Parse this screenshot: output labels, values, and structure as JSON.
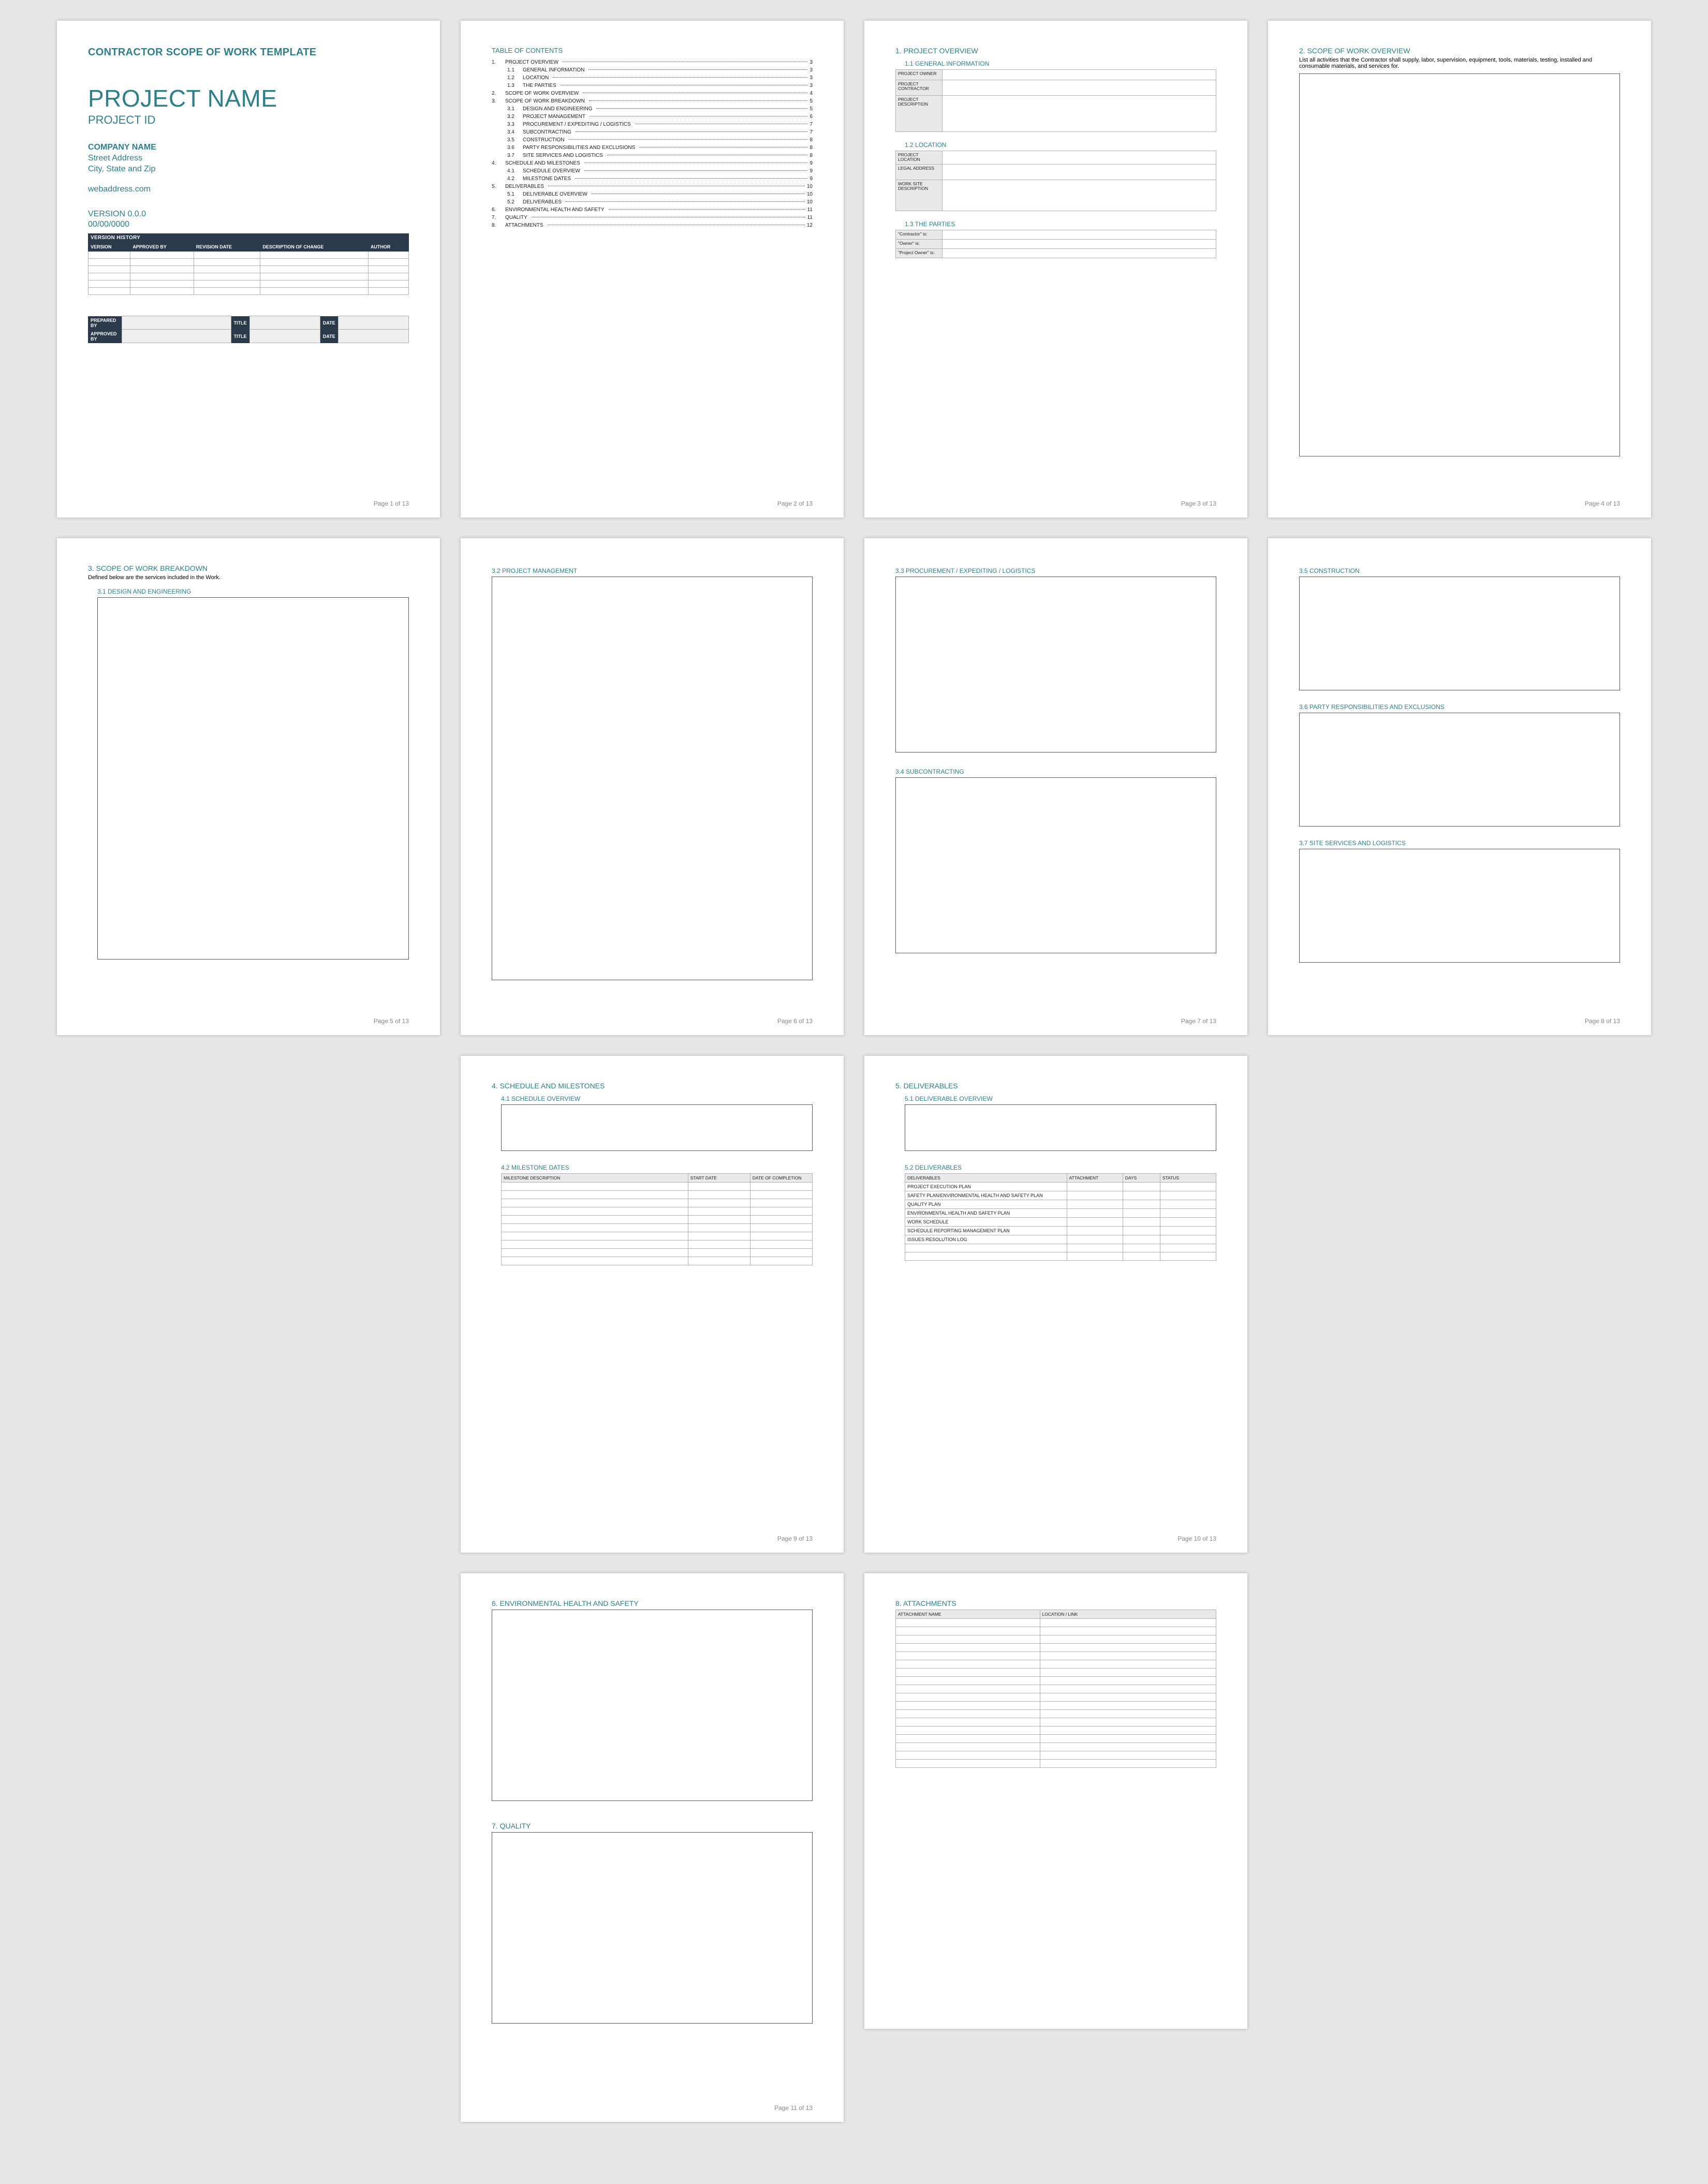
{
  "footer_prefix": "Page ",
  "footer_suffix": " of 13",
  "page1": {
    "doc_title": "CONTRACTOR SCOPE OF WORK TEMPLATE",
    "project_name": "PROJECT NAME",
    "project_id": "PROJECT ID",
    "company_name": "COMPANY NAME",
    "street": "Street Address",
    "city": "City, State and Zip",
    "web": "webaddress.com",
    "version": "VERSION 0.0.0",
    "date": "00/00/0000",
    "vh_title": "VERSION HISTORY",
    "vh_headers": [
      "VERSION",
      "APPROVED BY",
      "REVISION DATE",
      "DESCRIPTION OF CHANGE",
      "AUTHOR"
    ],
    "signoff": {
      "prepared": "PREPARED BY",
      "title": "TITLE",
      "date": "DATE",
      "approved": "APPROVED BY",
      "title2": "TITLE",
      "date2": "DATE"
    }
  },
  "page2": {
    "toc_title": "TABLE OF CONTENTS",
    "items": [
      {
        "n": "1.",
        "t": "PROJECT OVERVIEW",
        "p": "3",
        "sub": false
      },
      {
        "n": "1.1",
        "t": "GENERAL INFORMATION",
        "p": "3",
        "sub": true
      },
      {
        "n": "1.2",
        "t": "LOCATION",
        "p": "3",
        "sub": true
      },
      {
        "n": "1.3",
        "t": "THE PARTIES",
        "p": "3",
        "sub": true
      },
      {
        "n": "2.",
        "t": "SCOPE OF WORK OVERVIEW",
        "p": "4",
        "sub": false
      },
      {
        "n": "3.",
        "t": "SCOPE OF WORK BREAKDOWN",
        "p": "5",
        "sub": false
      },
      {
        "n": "3.1",
        "t": "DESIGN AND ENGINEERING",
        "p": "5",
        "sub": true
      },
      {
        "n": "3.2",
        "t": "PROJECT MANAGEMENT",
        "p": "6",
        "sub": true
      },
      {
        "n": "3.3",
        "t": "PROCUREMENT / EXPEDITING / LOGISTICS",
        "p": "7",
        "sub": true
      },
      {
        "n": "3.4",
        "t": "SUBCONTRACTING",
        "p": "7",
        "sub": true
      },
      {
        "n": "3.5",
        "t": "CONSTRUCTION",
        "p": "8",
        "sub": true
      },
      {
        "n": "3.6",
        "t": "PARTY RESPONSIBILITIES AND EXCLUSIONS",
        "p": "8",
        "sub": true
      },
      {
        "n": "3.7",
        "t": "SITE SERVICES AND LOGISTICS",
        "p": "8",
        "sub": true
      },
      {
        "n": "4.",
        "t": "SCHEDULE AND MILESTONES",
        "p": "9",
        "sub": false
      },
      {
        "n": "4.1",
        "t": "SCHEDULE OVERVIEW",
        "p": "9",
        "sub": true
      },
      {
        "n": "4.2",
        "t": "MILESTONE DATES",
        "p": "9",
        "sub": true
      },
      {
        "n": "5.",
        "t": "DELIVERABLES",
        "p": "10",
        "sub": false
      },
      {
        "n": "5.1",
        "t": "DELIVERABLE OVERVIEW",
        "p": "10",
        "sub": true
      },
      {
        "n": "5.2",
        "t": "DELIVERABLES",
        "p": "10",
        "sub": true
      },
      {
        "n": "6.",
        "t": "ENVIRONMENTAL HEALTH AND SAFETY",
        "p": "11",
        "sub": false
      },
      {
        "n": "7.",
        "t": "QUALITY",
        "p": "11",
        "sub": false
      },
      {
        "n": "8.",
        "t": "ATTACHMENTS",
        "p": "12",
        "sub": false
      }
    ]
  },
  "page3": {
    "h1": "1.  PROJECT OVERVIEW",
    "h11": "1.1    GENERAL INFORMATION",
    "kv1": [
      {
        "label": "PROJECT OWNER",
        "h": 20
      },
      {
        "label": "PROJECT CONTRACTOR",
        "h": 30
      },
      {
        "label": "PROJECT DESCRIPTION",
        "h": 70
      }
    ],
    "h12": "1.2    LOCATION",
    "kv2": [
      {
        "label": "PROJECT LOCATION",
        "h": 20
      },
      {
        "label": "LEGAL ADDRESS",
        "h": 30
      },
      {
        "label": "WORK SITE DESCRIPTION",
        "h": 60
      }
    ],
    "h13": "1.3    THE PARTIES",
    "kv3": [
      {
        "label": "\"Contractor\" is:",
        "h": 18
      },
      {
        "label": "\"Owner\" is:",
        "h": 18
      },
      {
        "label": "\"Project Owner\" is:",
        "h": 18
      }
    ]
  },
  "page4": {
    "h": "2.  SCOPE OF WORK OVERVIEW",
    "note": "List all activities that the Contractor shall supply, labor, supervision, equipment, tools, materials, testing, installed and consumable materials, and services for."
  },
  "page5": {
    "h": "3.  SCOPE OF WORK BREAKDOWN",
    "note": "Defined below are the services included in the Work.",
    "h31": "3.1    DESIGN AND ENGINEERING"
  },
  "page6": {
    "h32": "3.2    PROJECT MANAGEMENT"
  },
  "page7": {
    "h33": "3.3    PROCUREMENT / EXPEDITING / LOGISTICS",
    "h34": "3.4    SUBCONTRACTING"
  },
  "page8": {
    "h35": "3.5    CONSTRUCTION",
    "h36": "3.6    PARTY RESPONSIBILITIES AND EXCLUSIONS",
    "h37": "3.7    SITE SERVICES AND LOGISTICS"
  },
  "page9": {
    "h4": "4.  SCHEDULE AND MILESTONES",
    "h41": "4.1    SCHEDULE OVERVIEW",
    "h42": "4.2    MILESTONE DATES",
    "milestone_headers": [
      "MILESTONE DESCRIPTION",
      "START DATE",
      "DATE OF COMPLETION"
    ]
  },
  "page10": {
    "h5": "5.  DELIVERABLES",
    "h51": "5.1    DELIVERABLE OVERVIEW",
    "h52": "5.2    DELIVERABLES",
    "deliv_headers": [
      "DELIVERABLES",
      "ATTACHMENT",
      "DAYS",
      "STATUS"
    ],
    "deliv_rows": [
      "PROJECT EXECUTION PLAN",
      "SAFETY PLAN/ENVIRONMENTAL HEALTH AND SAFETY PLAN",
      "QUALITY PLAN",
      "ENVIRONMENTAL HEALTH AND SAFETY PLAN",
      "WORK SCHEDULE",
      "SCHEDULE REPORTING MANAGEMENT PLAN",
      "ISSUES RESOLUTION LOG"
    ]
  },
  "page11": {
    "h6": "6.  ENVIRONMENTAL HEALTH AND SAFETY",
    "h7": "7.  QUALITY"
  },
  "page12": {
    "h8": "8.  ATTACHMENTS",
    "attach_headers": [
      "ATTACHMENT NAME",
      "LOCATION / LINK"
    ]
  }
}
